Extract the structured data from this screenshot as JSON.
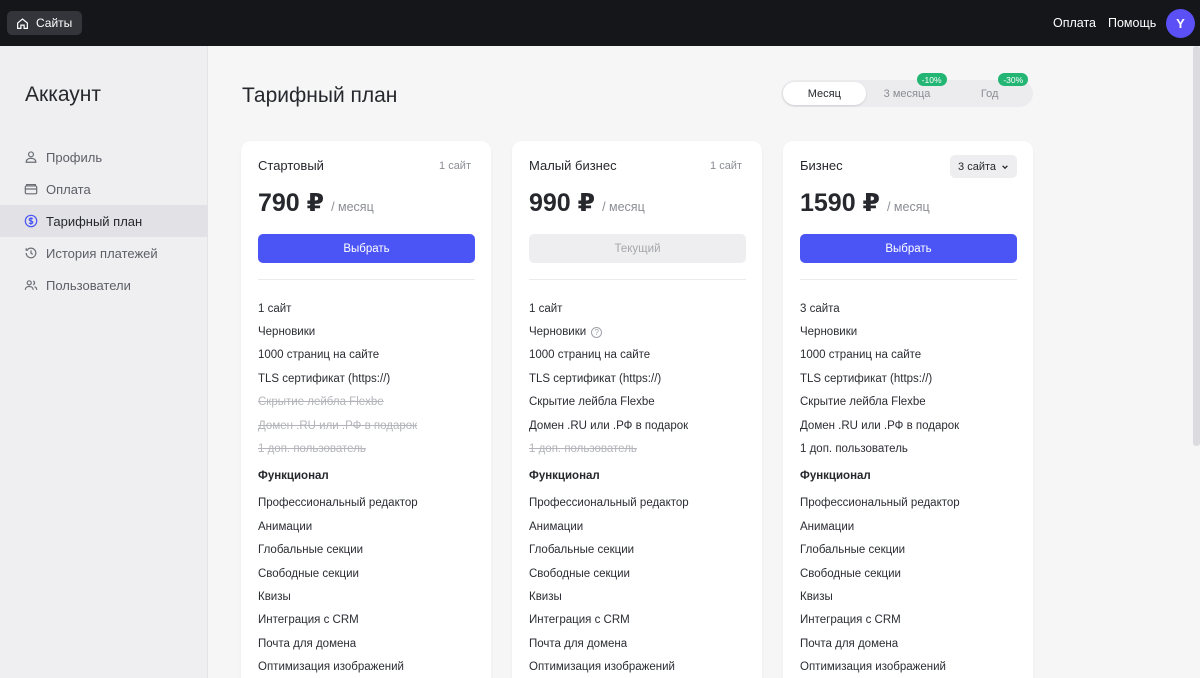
{
  "topbar": {
    "sites_label": "Сайты",
    "payment": "Оплата",
    "help": "Помощь",
    "avatar_letter": "Y"
  },
  "sidebar": {
    "title": "Аккаунт",
    "items": [
      {
        "label": "Профиль",
        "icon": "user-icon"
      },
      {
        "label": "Оплата",
        "icon": "wallet-icon"
      },
      {
        "label": "Тарифный план",
        "icon": "dollar-icon",
        "active": true
      },
      {
        "label": "История платежей",
        "icon": "history-icon"
      },
      {
        "label": "Пользователи",
        "icon": "users-icon"
      }
    ]
  },
  "page": {
    "title": "Тарифный план"
  },
  "period": {
    "options": [
      {
        "label": "Месяц",
        "active": true
      },
      {
        "label": "3 месяца",
        "badge": "-10%"
      },
      {
        "label": "Год",
        "badge": "-30%"
      }
    ]
  },
  "plans": [
    {
      "name": "Стартовый",
      "sites": "1 сайт",
      "price": "790 ₽",
      "per": "/ месяц",
      "button": "Выбрать",
      "features": [
        "1 сайт",
        "Черновики",
        "1000 страниц на сайте",
        "TLS сертификат (https://)",
        "Скрытие лейбла Flexbe",
        "Домен .RU или .РФ в подарок",
        "1 доп. пользователь"
      ],
      "section": "Функционал",
      "functions": [
        "Профессиональный редактор",
        "Анимации",
        "Глобальные секции",
        "Свободные секции",
        "Квизы",
        "Интеграция с CRM",
        "Почта для домена",
        "Оптимизация изображений"
      ]
    },
    {
      "name": "Малый бизнес",
      "sites": "1 сайт",
      "price": "990 ₽",
      "per": "/ месяц",
      "button": "Текущий",
      "features": [
        "1 сайт",
        "Черновики",
        "1000 страниц на сайте",
        "TLS сертификат (https://)",
        "Скрытие лейбла Flexbe",
        "Домен .RU или .РФ в подарок",
        "1 доп. пользователь"
      ],
      "section": "Функционал",
      "functions": [
        "Профессиональный редактор",
        "Анимации",
        "Глобальные секции",
        "Свободные секции",
        "Квизы",
        "Интеграция с CRM",
        "Почта для домена",
        "Оптимизация изображений"
      ]
    },
    {
      "name": "Бизнес",
      "sites": "3 сайта",
      "price": "1590 ₽",
      "per": "/ месяц",
      "button": "Выбрать",
      "features": [
        "3 сайта",
        "Черновики",
        "1000 страниц на сайте",
        "TLS сертификат (https://)",
        "Скрытие лейбла Flexbe",
        "Домен .RU или .РФ в подарок",
        "1 доп. пользователь"
      ],
      "section": "Функционал",
      "functions": [
        "Профессиональный редактор",
        "Анимации",
        "Глобальные секции",
        "Свободные секции",
        "Квизы",
        "Интеграция с CRM",
        "Почта для домена",
        "Оптимизация изображений"
      ]
    }
  ],
  "colors": {
    "accent": "#4b55f5",
    "avatar": "#5a50f5",
    "badge": "#22b573",
    "topbar": "#15161a"
  }
}
